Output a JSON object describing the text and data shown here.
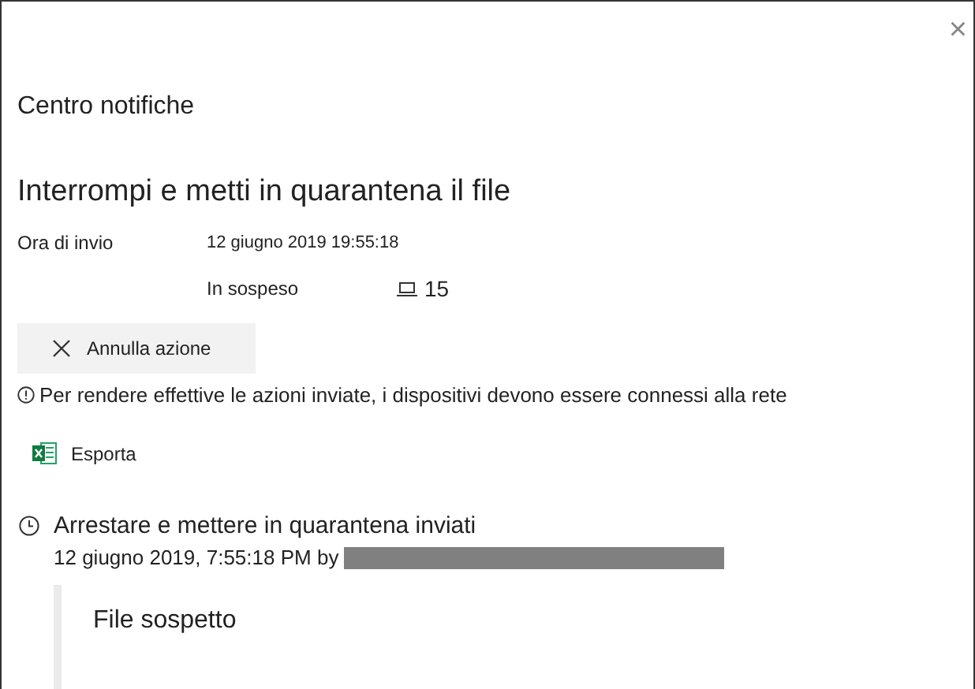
{
  "panel": {
    "title": "Centro notifiche",
    "close": "×"
  },
  "action": {
    "title": "Interrompi e metti in quarantena il file",
    "sent_label": "Ora di invio",
    "sent_value": "12 giugno 2019 19:55:18",
    "status": "In sospeso",
    "device_count": "15"
  },
  "cancel_button": "Annulla azione",
  "info": "Per rendere effettive le azioni inviate, i dispositivi devono essere connessi alla rete",
  "export_button": "Esporta",
  "history": {
    "title": "Arrestare e mettere in quarantena inviati",
    "timestamp": "12 giugno 2019, 7:55:18 PM by",
    "item": "File sospetto"
  }
}
